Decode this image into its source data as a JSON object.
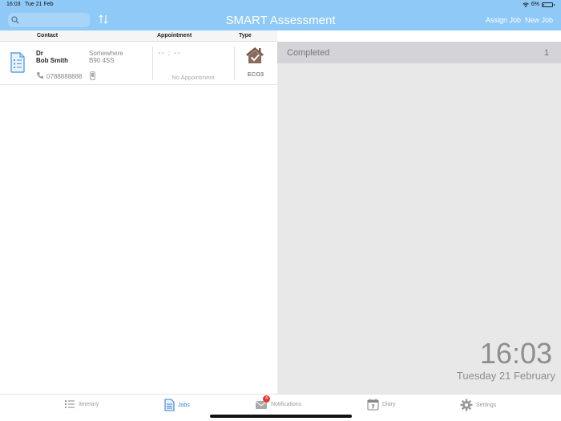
{
  "status_bar": {
    "time": "16:03",
    "date": "Tue 21 Feb",
    "battery": "6%",
    "battery_level": 0.06
  },
  "header": {
    "title": "SMART Assessment",
    "assign_job": "Assign Job",
    "new_job": "New Job",
    "search_placeholder": "",
    "color": "#8ec9f7"
  },
  "columns": {
    "contact": "Contact",
    "appointment": "Appointment",
    "type": "Type"
  },
  "jobs": [
    {
      "title": "Dr",
      "name": "Bob Smith",
      "address_line1": "Somewhere",
      "address_line2": "B90 4SS",
      "phone": "0788888888",
      "appointment_time": "-- : --",
      "appointment_status": "No Appointment",
      "type": "ECO3",
      "type_icon": "house-check-icon"
    }
  ],
  "right_panel": {
    "completed_label": "Completed",
    "completed_count": "1",
    "clock_time": "16:03",
    "clock_date": "Tuesday 21 February"
  },
  "tabs": [
    {
      "label": "Itinerary",
      "icon": "list-icon",
      "active": false
    },
    {
      "label": "Jobs",
      "icon": "document-icon",
      "active": true
    },
    {
      "label": "Notifications",
      "icon": "envelope-icon",
      "active": false,
      "badge": "4"
    },
    {
      "label": "Diary",
      "icon": "calendar-icon",
      "active": false,
      "day": "7"
    },
    {
      "label": "Settings",
      "icon": "gear-icon",
      "active": false
    }
  ],
  "accent_color": "#3a7fd8"
}
